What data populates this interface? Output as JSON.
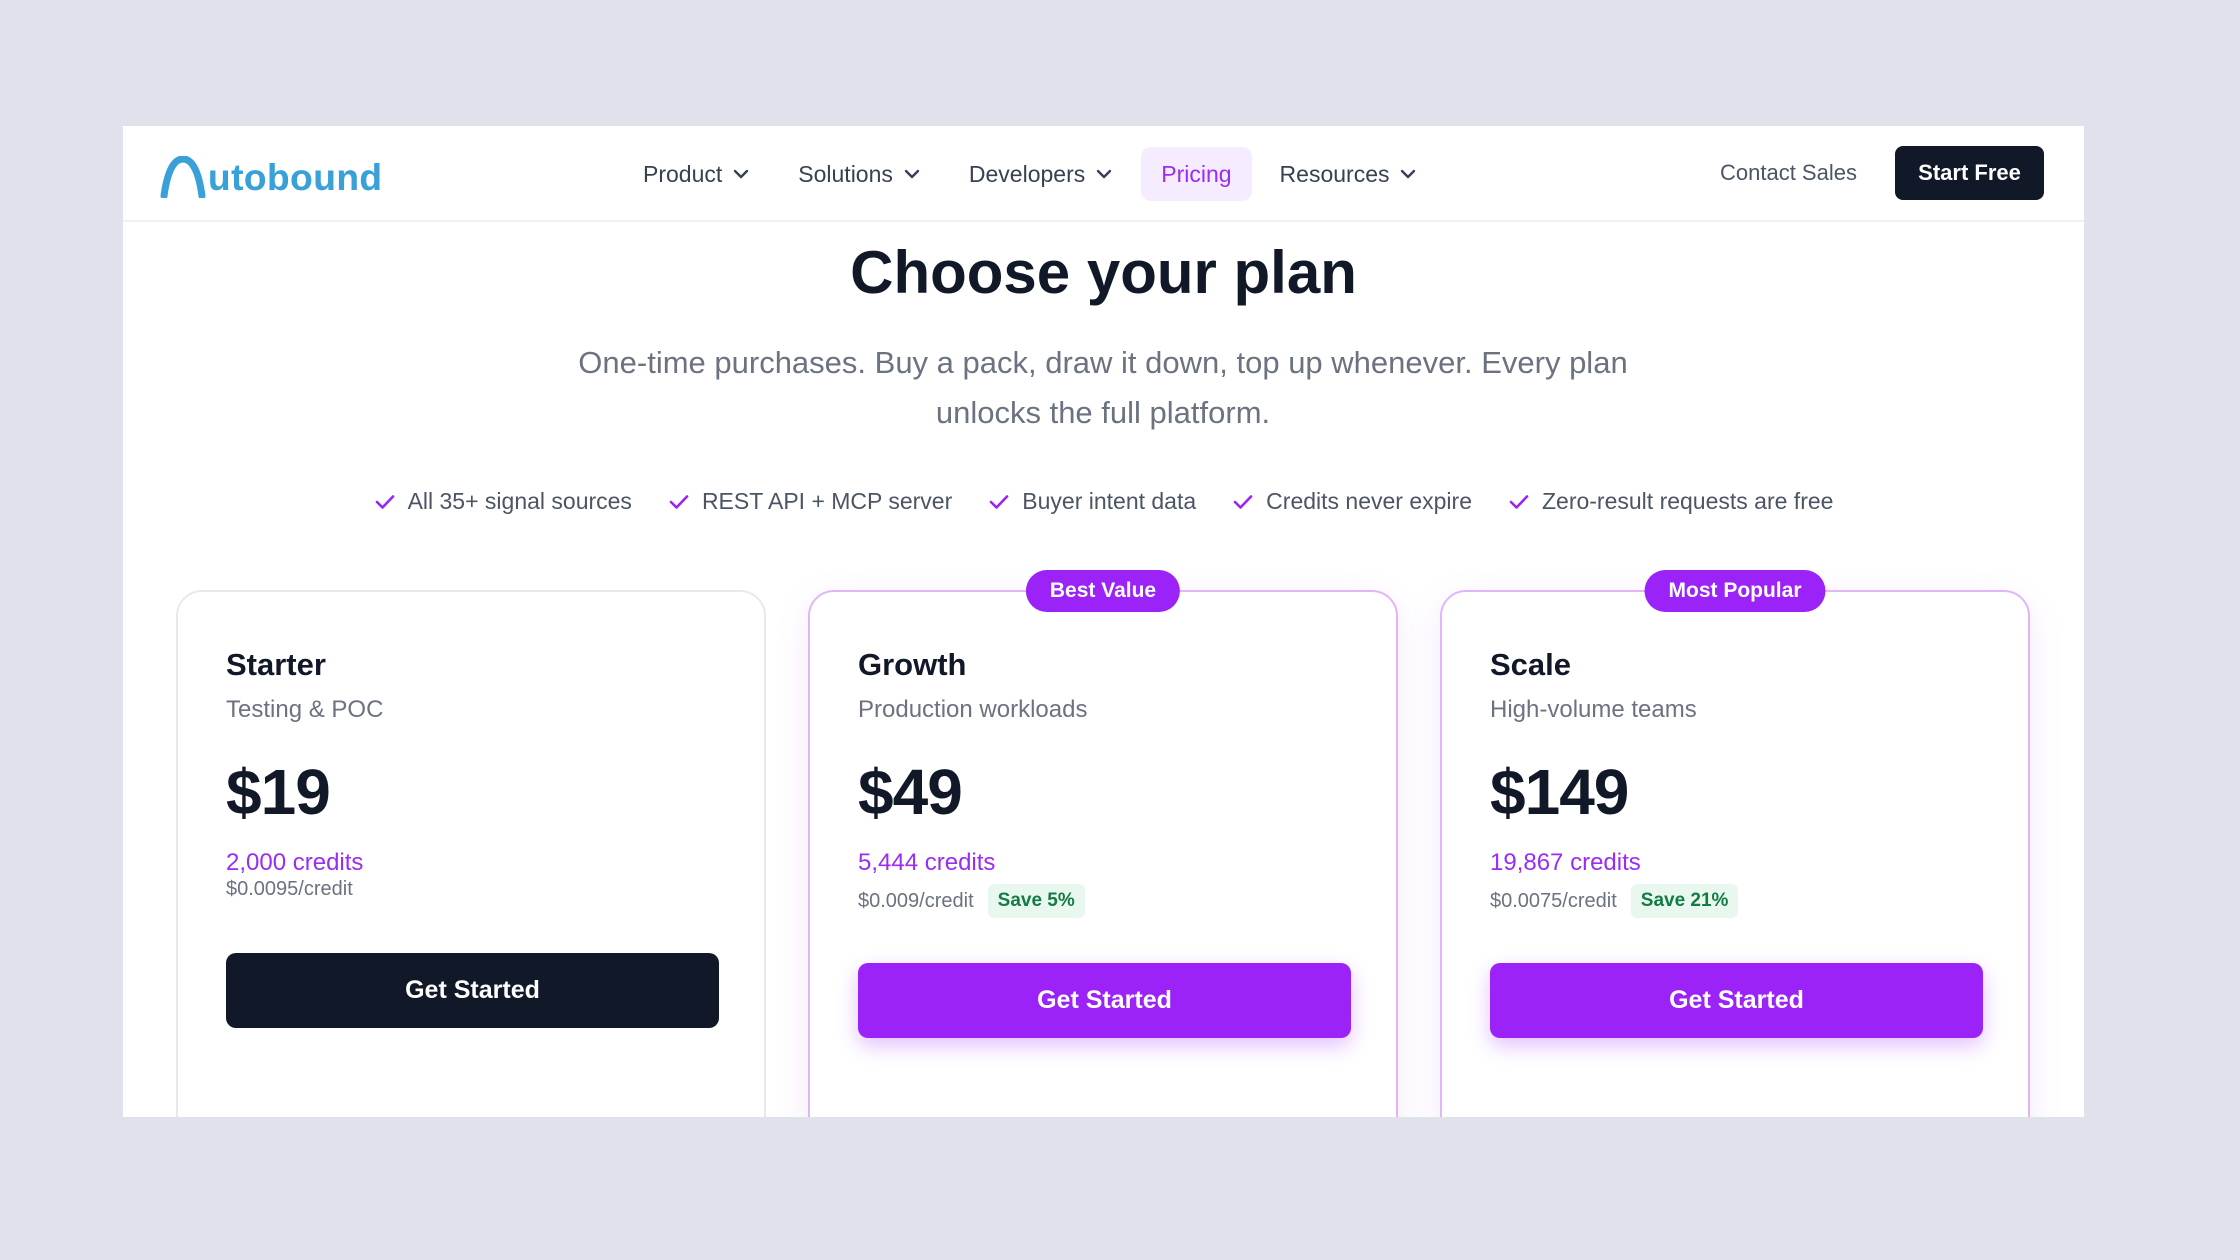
{
  "brand": {
    "logo_text": "utobound",
    "accent": "#9b23f7",
    "logo_color": "#3aa0d8"
  },
  "nav": {
    "items": [
      {
        "label": "Product",
        "dropdown": true
      },
      {
        "label": "Solutions",
        "dropdown": true
      },
      {
        "label": "Developers",
        "dropdown": true
      },
      {
        "label": "Pricing",
        "dropdown": false,
        "active": true
      },
      {
        "label": "Resources",
        "dropdown": true
      }
    ],
    "contact_label": "Contact Sales",
    "start_free_label": "Start Free"
  },
  "hero": {
    "title": "Choose your plan",
    "subtitle": "One-time purchases. Buy a pack, draw it down, top up whenever. Every plan unlocks the full platform."
  },
  "features": [
    "All 35+ signal sources",
    "REST API + MCP server",
    "Buyer intent data",
    "Credits never expire",
    "Zero-result requests are free"
  ],
  "plans": [
    {
      "name": "Starter",
      "description": "Testing & POC",
      "price": "$19",
      "credits": "2,000 credits",
      "rate": "$0.0095/credit",
      "save": "",
      "badge": "",
      "cta": "Get Started"
    },
    {
      "name": "Growth",
      "description": "Production workloads",
      "price": "$49",
      "credits": "5,444 credits",
      "rate": "$0.009/credit",
      "save": "Save 5%",
      "badge": "Best Value",
      "cta": "Get Started"
    },
    {
      "name": "Scale",
      "description": "High-volume teams",
      "price": "$149",
      "credits": "19,867 credits",
      "rate": "$0.0075/credit",
      "save": "Save 21%",
      "badge": "Most Popular",
      "cta": "Get Started"
    }
  ]
}
